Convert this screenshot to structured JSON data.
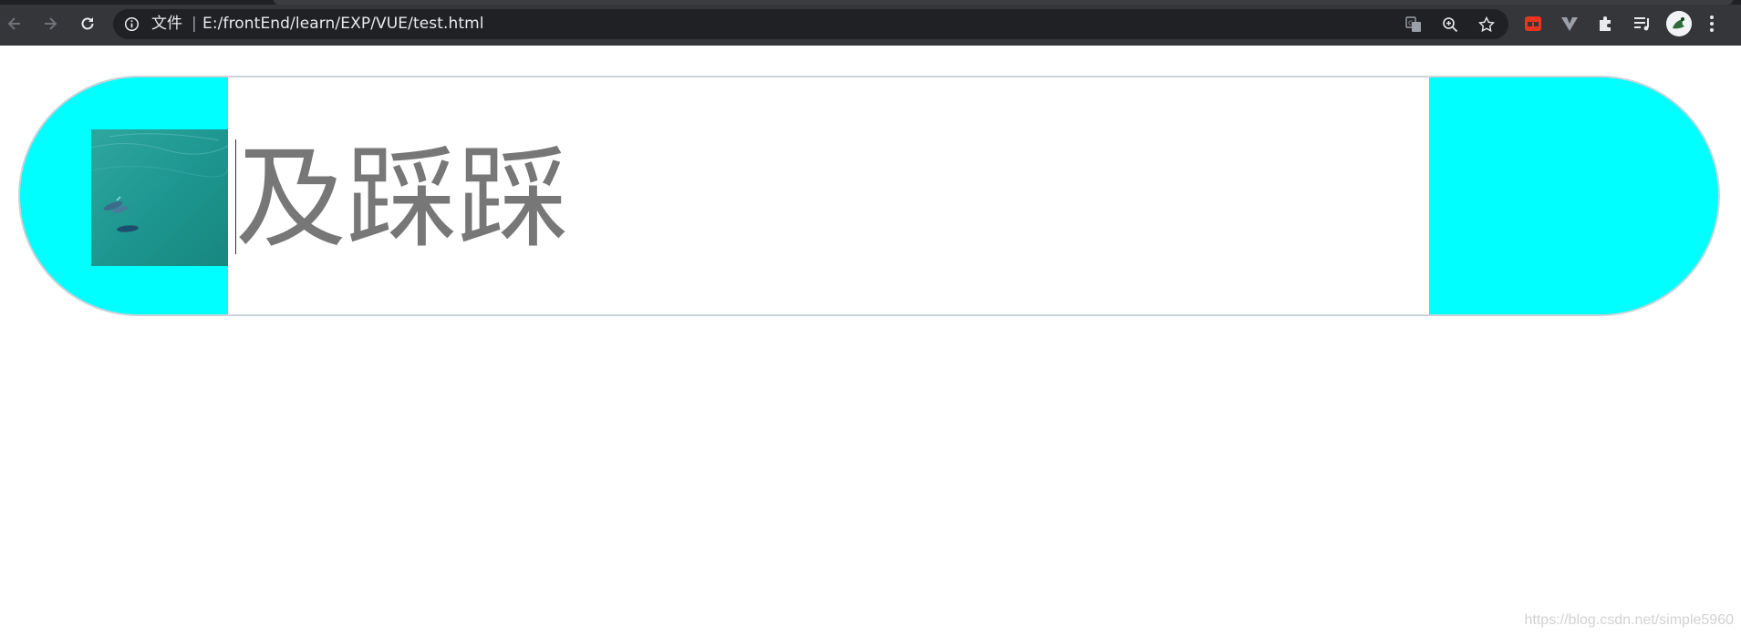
{
  "browser": {
    "scheme_label": "文件",
    "separator": "|",
    "url": "E:/frontEnd/learn/EXP/VUE/test.html",
    "icons": {
      "back": "back-arrow-icon",
      "forward": "forward-arrow-icon",
      "reload": "reload-icon",
      "info": "info-icon",
      "translate": "translate-icon",
      "zoom": "zoom-icon",
      "bookmark": "star-icon",
      "extension_red": "extension-red-icon",
      "extension_v": "extension-v-icon",
      "extensions": "puzzle-icon",
      "reading_list": "reading-list-icon",
      "profile": "avatar",
      "menu": "kebab-menu-icon"
    },
    "colors": {
      "toolbar": "#35363a",
      "omnibox": "#202124",
      "text": "#e8eaed"
    }
  },
  "page": {
    "content_text": "及踩踩",
    "colors": {
      "pill_background": "#00ffff",
      "inner_background": "#ffffff",
      "text": "#777777"
    }
  },
  "watermark": "https://blog.csdn.net/simple5960"
}
